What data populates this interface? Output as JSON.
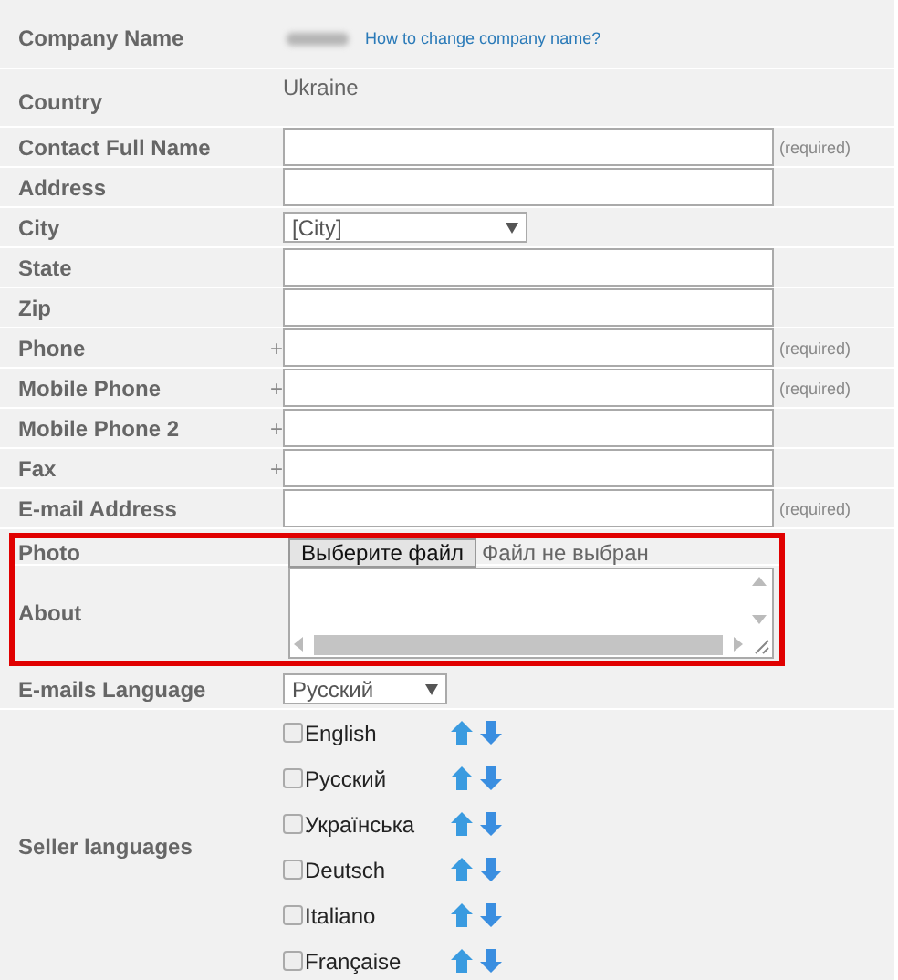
{
  "rows": [
    {
      "kind": "company",
      "label": "Company Name",
      "link": "How to change company name?"
    },
    {
      "kind": "static",
      "label": "Country",
      "value": "Ukraine"
    },
    {
      "kind": "text",
      "label": "Contact Full Name",
      "note": "(required)"
    },
    {
      "kind": "text",
      "label": "Address"
    },
    {
      "kind": "combo",
      "label": "City",
      "value": "[City]"
    },
    {
      "kind": "text",
      "label": "State"
    },
    {
      "kind": "text",
      "label": "Zip"
    },
    {
      "kind": "text",
      "label": "Phone",
      "prefix": "+",
      "note": "(required)"
    },
    {
      "kind": "text",
      "label": "Mobile Phone",
      "prefix": "+",
      "note": "(required)"
    },
    {
      "kind": "text",
      "label": "Mobile Phone 2",
      "prefix": "+"
    },
    {
      "kind": "text",
      "label": "Fax",
      "prefix": "+"
    },
    {
      "kind": "text",
      "label": "E-mail Address",
      "note": "(required)"
    },
    {
      "kind": "highlight",
      "rows": [
        {
          "kind": "file",
          "label": "Photo",
          "button": "Выберите файл",
          "status": "Файл не выбран"
        },
        {
          "kind": "textarea",
          "label": "About"
        }
      ]
    },
    {
      "kind": "select",
      "label": "E-mails Language",
      "value": "Русский"
    },
    {
      "kind": "checklist",
      "label": "Seller languages",
      "items": [
        {
          "label": "English",
          "checked": false
        },
        {
          "label": "Русский",
          "checked": false
        },
        {
          "label": "Українська",
          "checked": false
        },
        {
          "label": "Deutsch",
          "checked": false
        },
        {
          "label": "Italiano",
          "checked": false
        },
        {
          "label": "Française",
          "checked": false
        }
      ]
    }
  ]
}
